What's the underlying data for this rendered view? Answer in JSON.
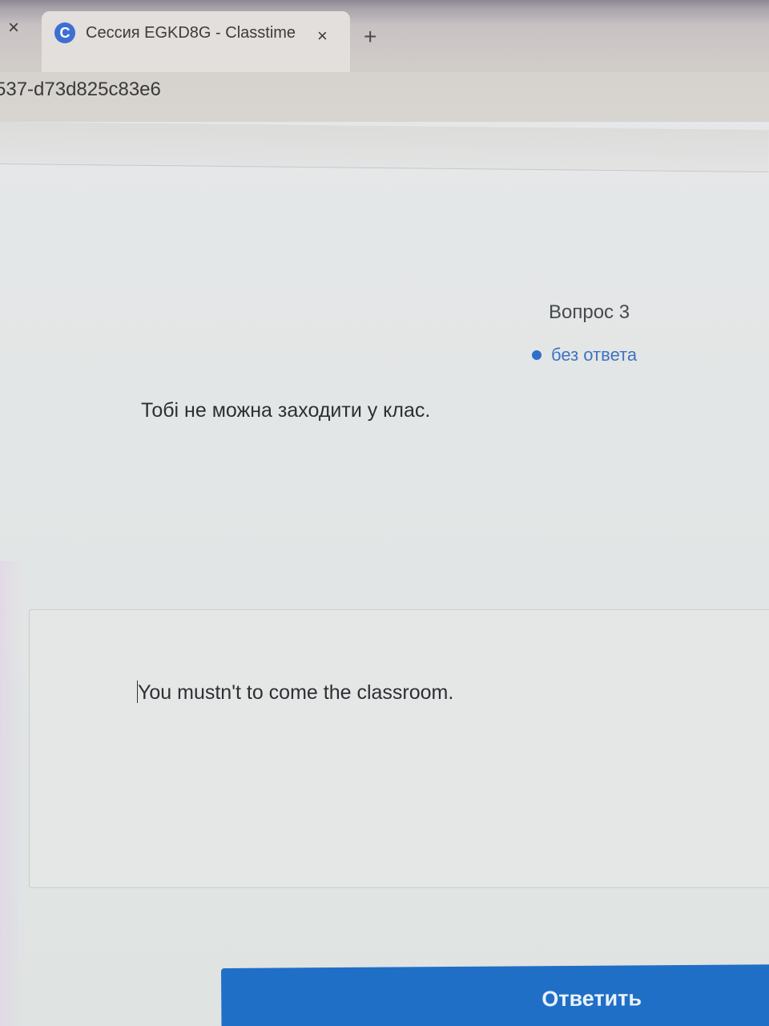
{
  "browser": {
    "prev_tab_close_icon": "×",
    "active_tab": {
      "favicon_letter": "C",
      "title": "Сессия EGKD8G - Classtime",
      "close_icon": "×"
    },
    "new_tab_icon": "+",
    "url": "537-d73d825c83e6"
  },
  "question": {
    "number_label": "Вопрос 3",
    "status_label": "без ответа",
    "prompt": "Тобі не можна заходити у клас."
  },
  "answer": {
    "value": "You mustn't to come the classroom."
  },
  "actions": {
    "submit_label": "Ответить"
  },
  "colors": {
    "accent": "#1f6fc6",
    "status": "#3f73c4"
  }
}
